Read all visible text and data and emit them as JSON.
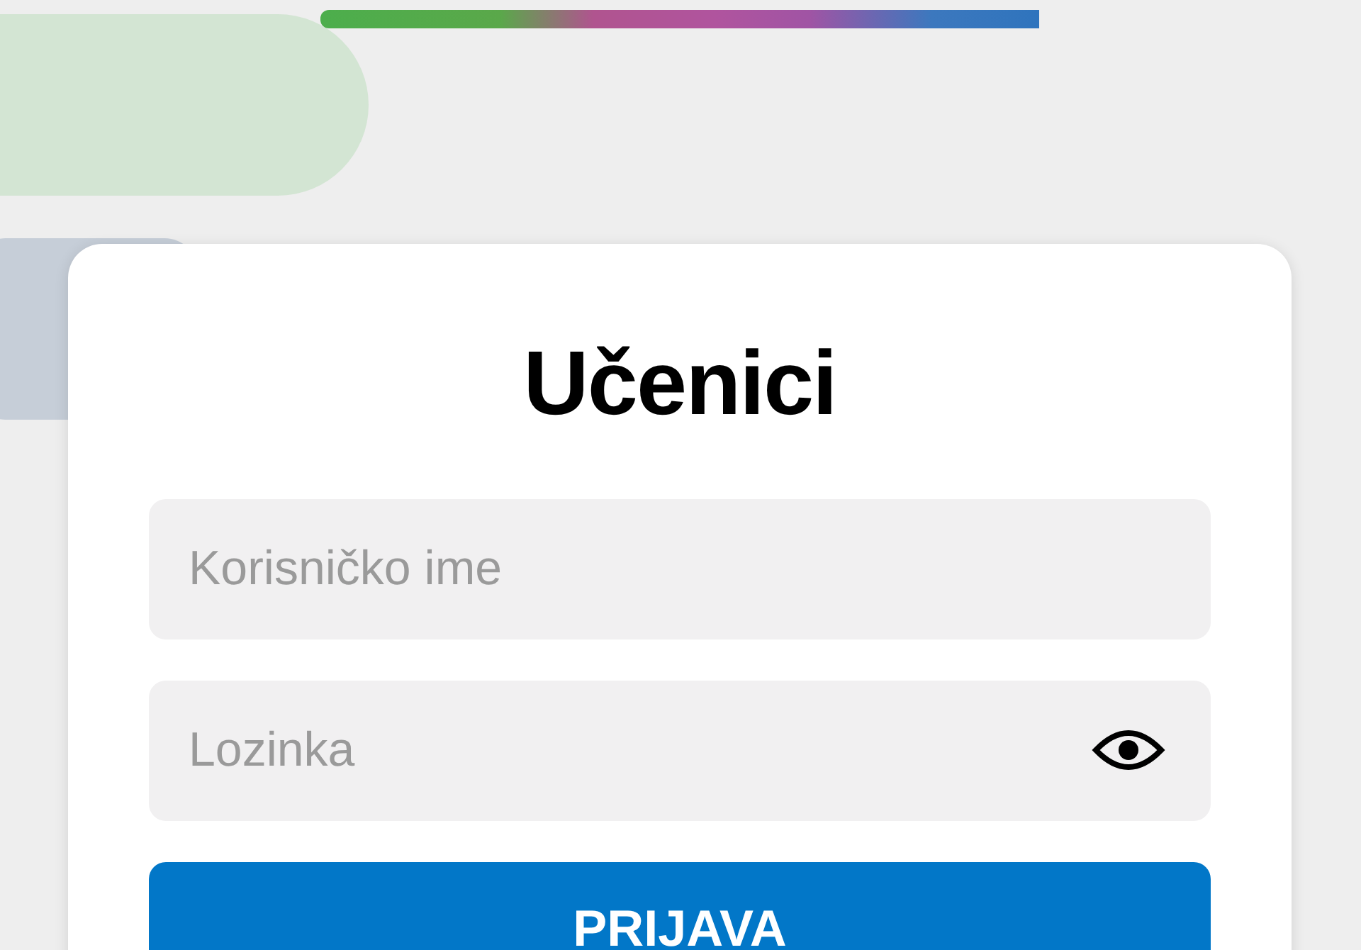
{
  "title": "Učenici",
  "fields": [
    {
      "kind": "text",
      "placeholder": "Korisničko ime"
    },
    {
      "kind": "password",
      "placeholder": "Lozinka"
    }
  ],
  "button": "PRIJAVA"
}
